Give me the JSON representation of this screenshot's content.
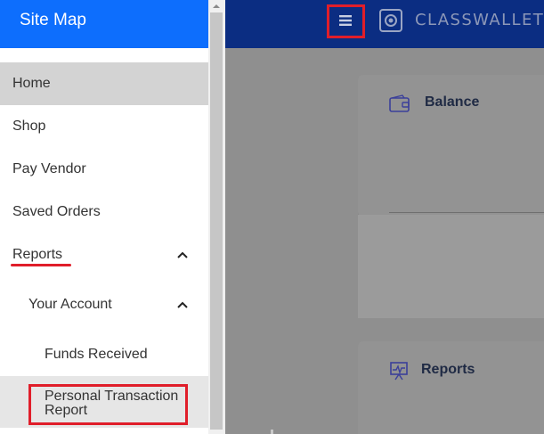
{
  "sidebar": {
    "title": "Site Map",
    "items": {
      "home": "Home",
      "shop": "Shop",
      "pay_vendor": "Pay Vendor",
      "saved_orders": "Saved Orders",
      "reports": "Reports",
      "your_account": "Your Account",
      "funds_received": "Funds Received",
      "personal_transaction_line1": "Personal Transaction",
      "personal_transaction_line2": "Report"
    }
  },
  "header": {
    "brand": "CLASSWALLET",
    "menu_icon": "hamburger-menu-icon",
    "logo_icon": "classwallet-logo-icon"
  },
  "main": {
    "balance_card": {
      "title": "Balance",
      "icon": "wallet-icon"
    },
    "reports_card": {
      "title": "Reports",
      "icon": "chart-presentation-icon"
    }
  },
  "colors": {
    "sidebar_header": "#0d6efd",
    "app_header": "#0b2d82",
    "highlight_red": "#e01e2a",
    "active_item": "#d3d3d3"
  }
}
